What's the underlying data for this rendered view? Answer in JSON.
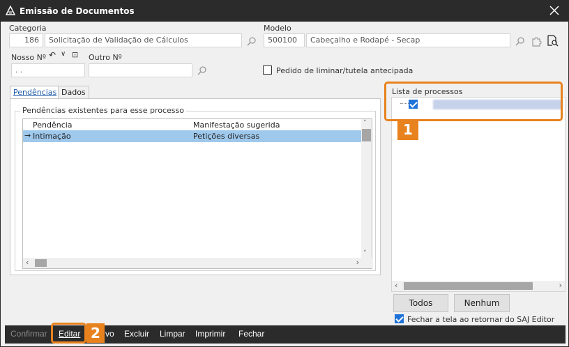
{
  "window": {
    "title": "Emissão de Documentos"
  },
  "form": {
    "categoria_label": "Categoria",
    "categoria_code": "186",
    "categoria_desc": "Solicitação de Validação de Cálculos",
    "modelo_label": "Modelo",
    "modelo_code": "500100",
    "modelo_desc": "Cabeçalho e Rodapé - Secap",
    "nosso_label": "Nosso Nº",
    "nosso_value": ". .",
    "outro_label": "Outro Nº",
    "outro_value": "",
    "liminar_label": "Pedido de liminar/tutela antecipada",
    "liminar_checked": false
  },
  "tabs": [
    {
      "label": "Pendências",
      "active": true
    },
    {
      "label": "Dados",
      "active": false
    }
  ],
  "pendencias": {
    "group_title": "Pendências existentes para esse processo",
    "columns": [
      "Pendência",
      "Manifestação sugerida"
    ],
    "rows": [
      {
        "pendencia": "Intimação",
        "manifestacao": "Petições diversas",
        "selected": true
      }
    ]
  },
  "lista": {
    "title": "Lista de processos",
    "item_checked": true
  },
  "annotations": {
    "badge1": "1",
    "badge2": "2"
  },
  "buttons": {
    "todos": "Todos",
    "nenhum": "Nenhum"
  },
  "fechar_option": {
    "label": "Fechar a tela ao retornar do SAJ Editor",
    "checked": true
  },
  "toolbar": {
    "confirmar": "Confirmar",
    "editar": "Editar",
    "novo_partial": "vo",
    "excluir": "Excluir",
    "limpar": "Limpar",
    "imprimir": "Imprimir",
    "fechar": "Fechar"
  },
  "colors": {
    "accent": "#e8821e",
    "selection": "#9ec8ec",
    "check": "#1e73d8",
    "titlebar": "#2b2b2b"
  }
}
